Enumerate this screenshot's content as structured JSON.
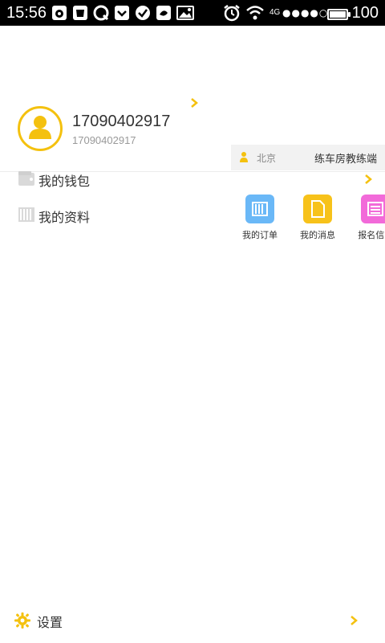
{
  "status_bar": {
    "time": "15:56",
    "network": "4G",
    "signal_dots": "●●●●○",
    "battery_level": 1.0,
    "battery_text": "100",
    "icons": [
      "weibo-icon",
      "shop-icon",
      "q-icon",
      "pocket-icon",
      "check-icon",
      "bird-icon",
      "gallery-icon",
      "alarm-icon",
      "wifi-icon"
    ]
  },
  "profile": {
    "phone": "17090402917",
    "sub": "17090402917"
  },
  "menu": {
    "items": [
      {
        "label": "我的钱包",
        "icon": "wallet-icon"
      },
      {
        "label": "我的资料",
        "icon": "profile-docs-icon"
      }
    ]
  },
  "side_panel": {
    "city": "北京",
    "app_name": "练车房教练端",
    "tiles": [
      {
        "label": "我的订单",
        "color": "#6ab8f7",
        "icon": "orders-icon"
      },
      {
        "label": "我的消息",
        "color": "#f7c21a",
        "icon": "message-icon"
      },
      {
        "label": "报名信...",
        "color": "#f26ad9",
        "icon": "signup-icon"
      }
    ]
  },
  "settings": {
    "label": "设置",
    "icon": "gear-icon"
  },
  "accent": "#f4c10f"
}
